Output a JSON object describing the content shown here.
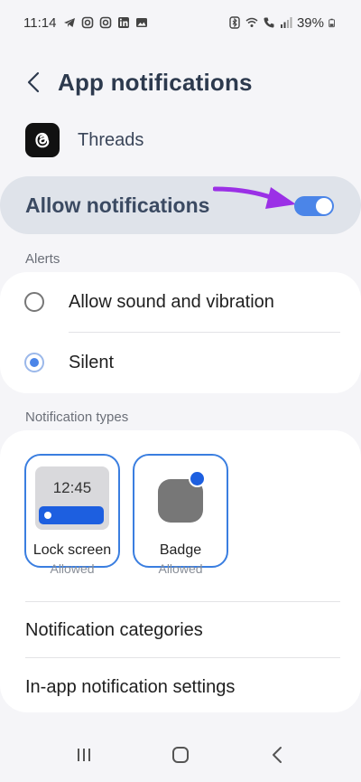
{
  "status_bar": {
    "time": "11:14",
    "battery": "39%",
    "left_icons": [
      "telegram-icon",
      "instagram-icon",
      "instagram-icon",
      "linkedin-icon",
      "gallery-icon"
    ],
    "right_icons": [
      "bluetooth-icon",
      "wifi-icon",
      "call-icon",
      "signal-icon",
      "battery-icon"
    ]
  },
  "header": {
    "title": "App notifications",
    "back_icon": "chevron-left-icon"
  },
  "app": {
    "name": "Threads",
    "icon": "threads-logo-icon"
  },
  "allow_notifications": {
    "label": "Allow notifications",
    "enabled": true,
    "accent_color": "#4b85e8",
    "annotation_arrow_color": "#9b30e6"
  },
  "alerts": {
    "section_label": "Alerts",
    "options": [
      {
        "label": "Allow sound and vibration",
        "selected": false
      },
      {
        "label": "Silent",
        "selected": true
      }
    ]
  },
  "notification_types": {
    "section_label": "Notification types",
    "tiles": [
      {
        "name": "Lock screen",
        "state": "Allowed",
        "preview_time": "12:45"
      },
      {
        "name": "Badge",
        "state": "Allowed"
      }
    ]
  },
  "links": {
    "categories": "Notification categories",
    "in_app": "In-app notification settings"
  },
  "nav_bar": {
    "items": [
      "recents-icon",
      "home-icon",
      "back-icon"
    ]
  }
}
